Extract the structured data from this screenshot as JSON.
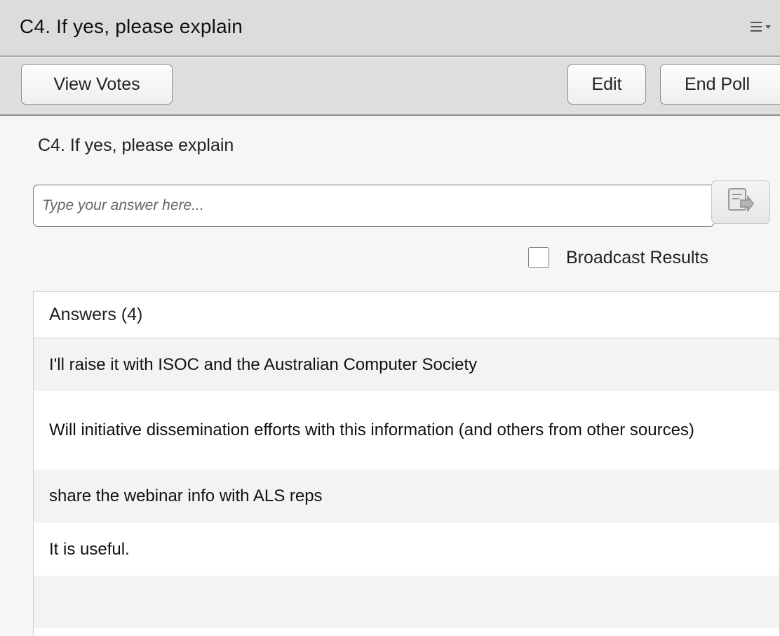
{
  "header": {
    "title": "C4. If yes,  please explain",
    "menu_icon": "hamburger-dropdown-icon"
  },
  "toolbar": {
    "view_votes_label": "View Votes",
    "edit_label": "Edit",
    "end_poll_label": "End Poll"
  },
  "poll": {
    "question": "C4. If yes,  please explain",
    "answer_input": {
      "value": "",
      "placeholder": "Type your answer here..."
    },
    "submit_icon": "submit-answer-icon",
    "broadcast_results": {
      "label": "Broadcast Results",
      "checked": false
    },
    "answers_header": "Answers (4)",
    "answers": [
      "I'll raise it with ISOC and the Australian Computer Society",
      "Will initiative dissemination efforts with this information (and others from other sources)",
      "share the webinar info with ALS reps",
      "It is useful."
    ]
  },
  "colors": {
    "titlebar_bg": "#dcdcdc",
    "panel_bg": "#f6f6f6",
    "row_alt_bg": "#f3f3f3"
  }
}
